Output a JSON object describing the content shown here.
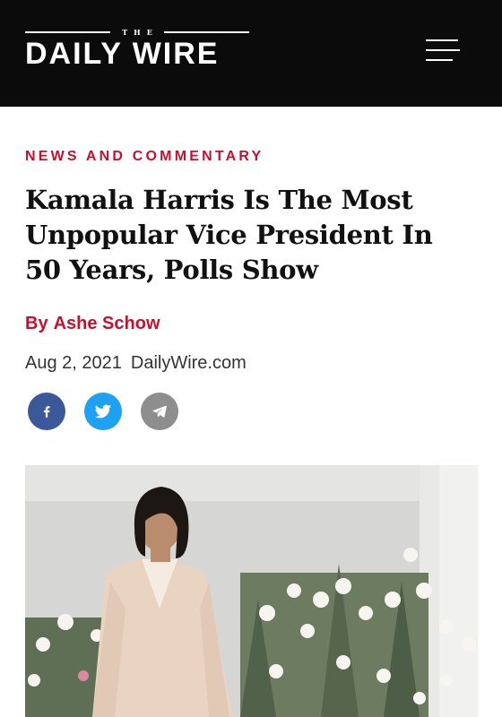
{
  "header": {
    "logo_small": "THE",
    "logo_main": "DAILY WIRE",
    "background": "#0b0b0b"
  },
  "article": {
    "category": "NEWS AND COMMENTARY",
    "title": "Kamala Harris Is The Most Unpopular Vice President In 50 Years, Polls Show",
    "byline_prefix": "By",
    "author": "Ashe Schow",
    "date": "Aug 2, 2021",
    "source": "DailyWire.com",
    "accent": "#c8102e"
  },
  "share": [
    {
      "network": "facebook",
      "icon": "facebook-icon",
      "color": "#3b5998"
    },
    {
      "network": "twitter",
      "icon": "twitter-icon",
      "color": "#1da1f2"
    },
    {
      "network": "telegram",
      "icon": "telegram-icon",
      "color": "#8e8e8e"
    }
  ],
  "hero_image": {
    "subject": "woman-in-cream-suit-with-white-roses"
  }
}
